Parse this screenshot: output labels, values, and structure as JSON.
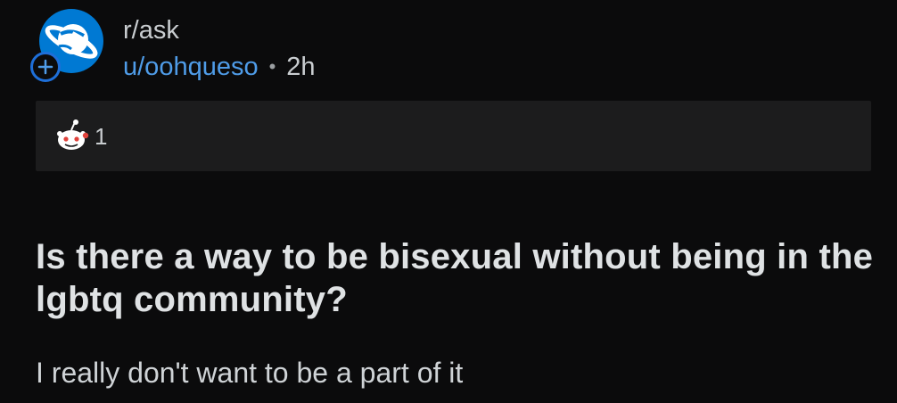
{
  "post": {
    "subreddit": "r/ask",
    "username": "u/oohqueso",
    "separator": "•",
    "age": "2h",
    "award_count": "1",
    "title": "Is there a way to be bisexual without being in the lgbtq community?",
    "body": "I really don't want to be a part of it"
  },
  "icons": {
    "subreddit_avatar": "planet-icon",
    "join": "plus-icon",
    "award": "snoo-award-icon"
  },
  "colors": {
    "background": "#0b0b0c",
    "avatar": "#0079d3",
    "username": "#4f9ce8",
    "award_bar": "#1c1c1d",
    "text": "#dfe2e4"
  }
}
